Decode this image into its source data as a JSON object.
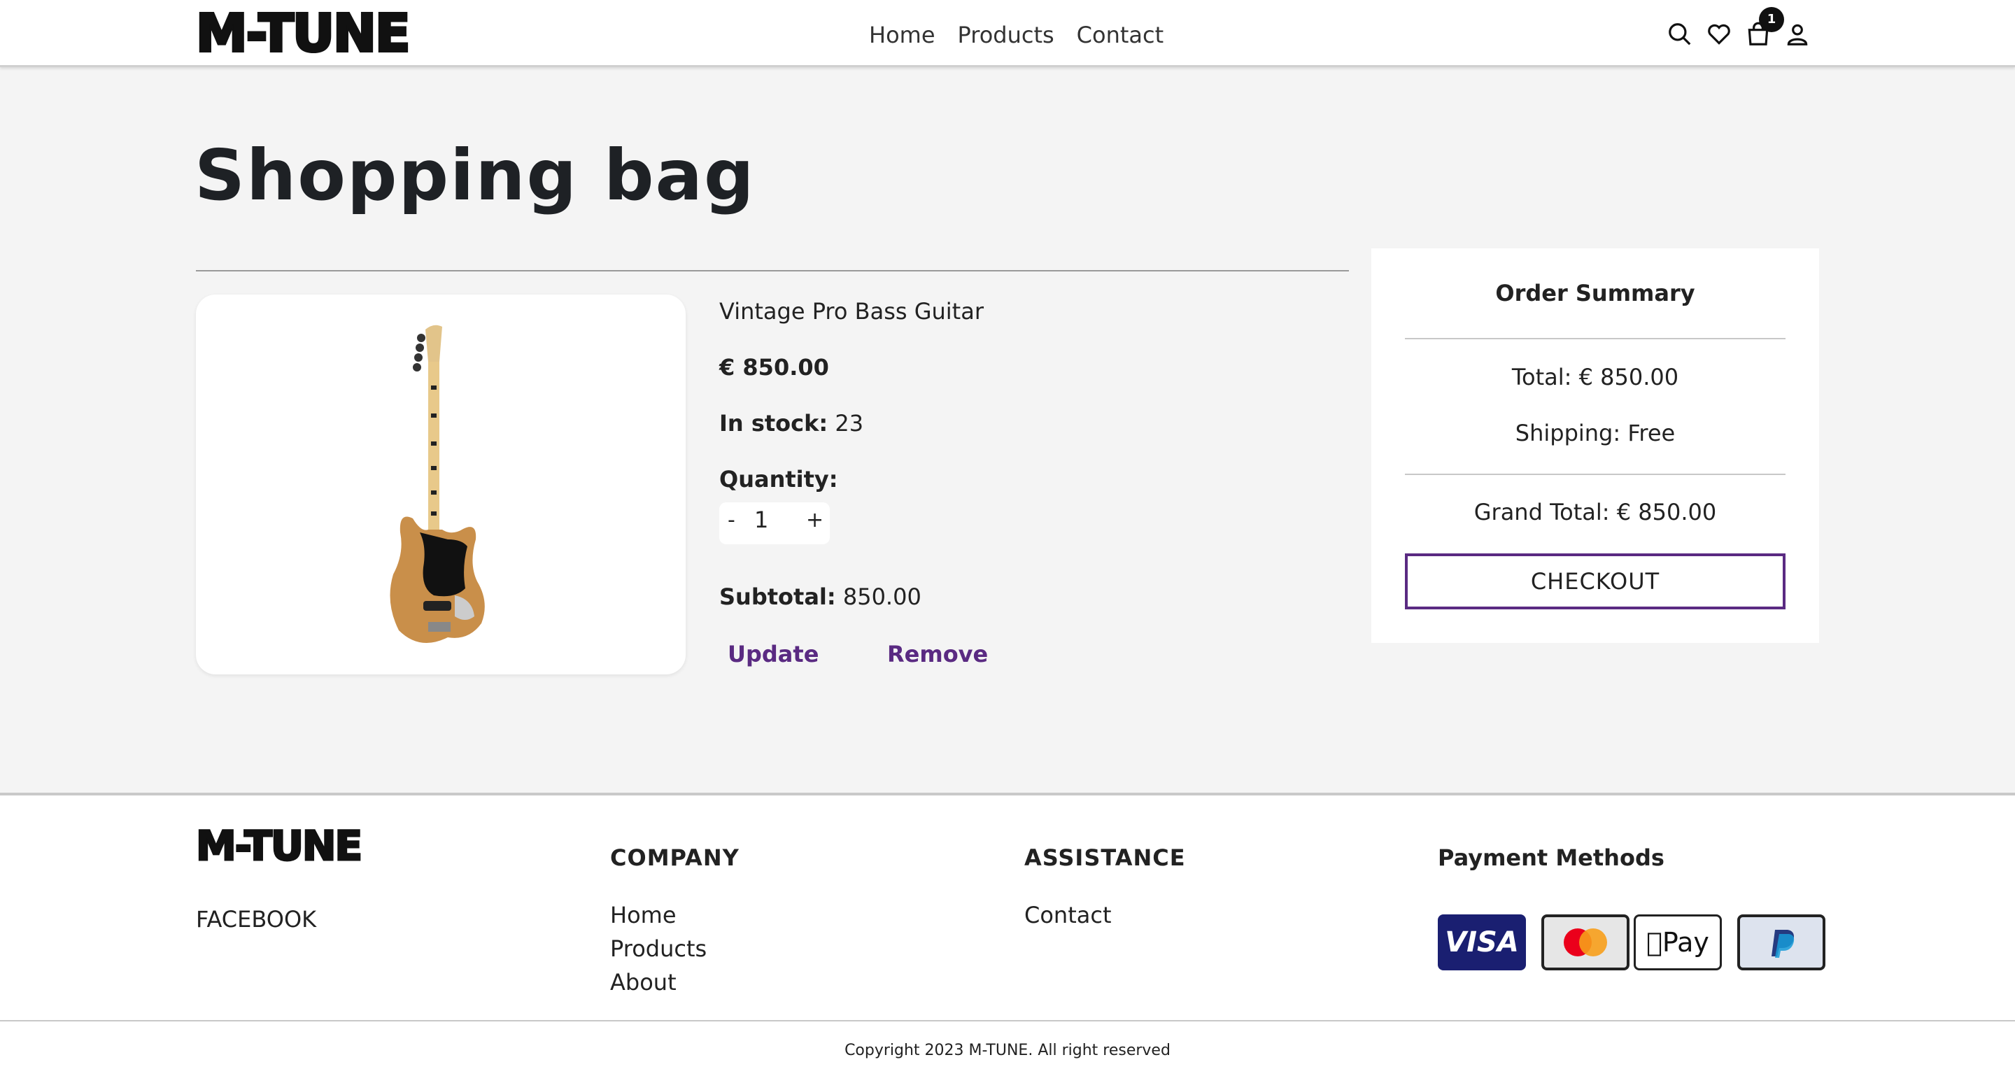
{
  "header": {
    "logo": "M-TUNE",
    "nav": [
      "Home",
      "Products",
      "Contact"
    ],
    "cart_count": "1",
    "icons": [
      "search-icon",
      "heart-icon",
      "shopping-bag-icon",
      "user-icon"
    ]
  },
  "page": {
    "title": "Shopping bag"
  },
  "product": {
    "name": "Vintage Pro Bass Guitar",
    "price": "€ 850.00",
    "stock_label": "In stock:",
    "stock_value": "23",
    "quantity_label": "Quantity:",
    "qty_minus": "-",
    "qty_value": "1",
    "qty_plus": "+",
    "subtotal_label": "Subtotal:",
    "subtotal_value": "850.00",
    "update_label": "Update",
    "remove_label": "Remove"
  },
  "summary": {
    "title": "Order Summary",
    "total": "Total: € 850.00",
    "shipping": "Shipping: Free",
    "grand_total": "Grand Total: € 850.00",
    "checkout_label": "CHECKOUT"
  },
  "footer": {
    "logo": "M-TUNE",
    "facebook": "FACEBOOK",
    "company_heading": "COMPANY",
    "company_links": [
      "Home",
      "Products",
      "About"
    ],
    "assistance_heading": "ASSISTANCE",
    "assistance_links": [
      "Contact"
    ],
    "payment_heading": "Payment Methods",
    "payment_methods": [
      "VISA",
      "Mastercard",
      "Pay",
      "PayPal"
    ],
    "copyright": "Copyright 2023 M-TUNE. All right reserved"
  },
  "colors": {
    "accent": "#5a2a82",
    "page_bg": "#f4f4f4",
    "visa_bg": "#1a1f71"
  }
}
